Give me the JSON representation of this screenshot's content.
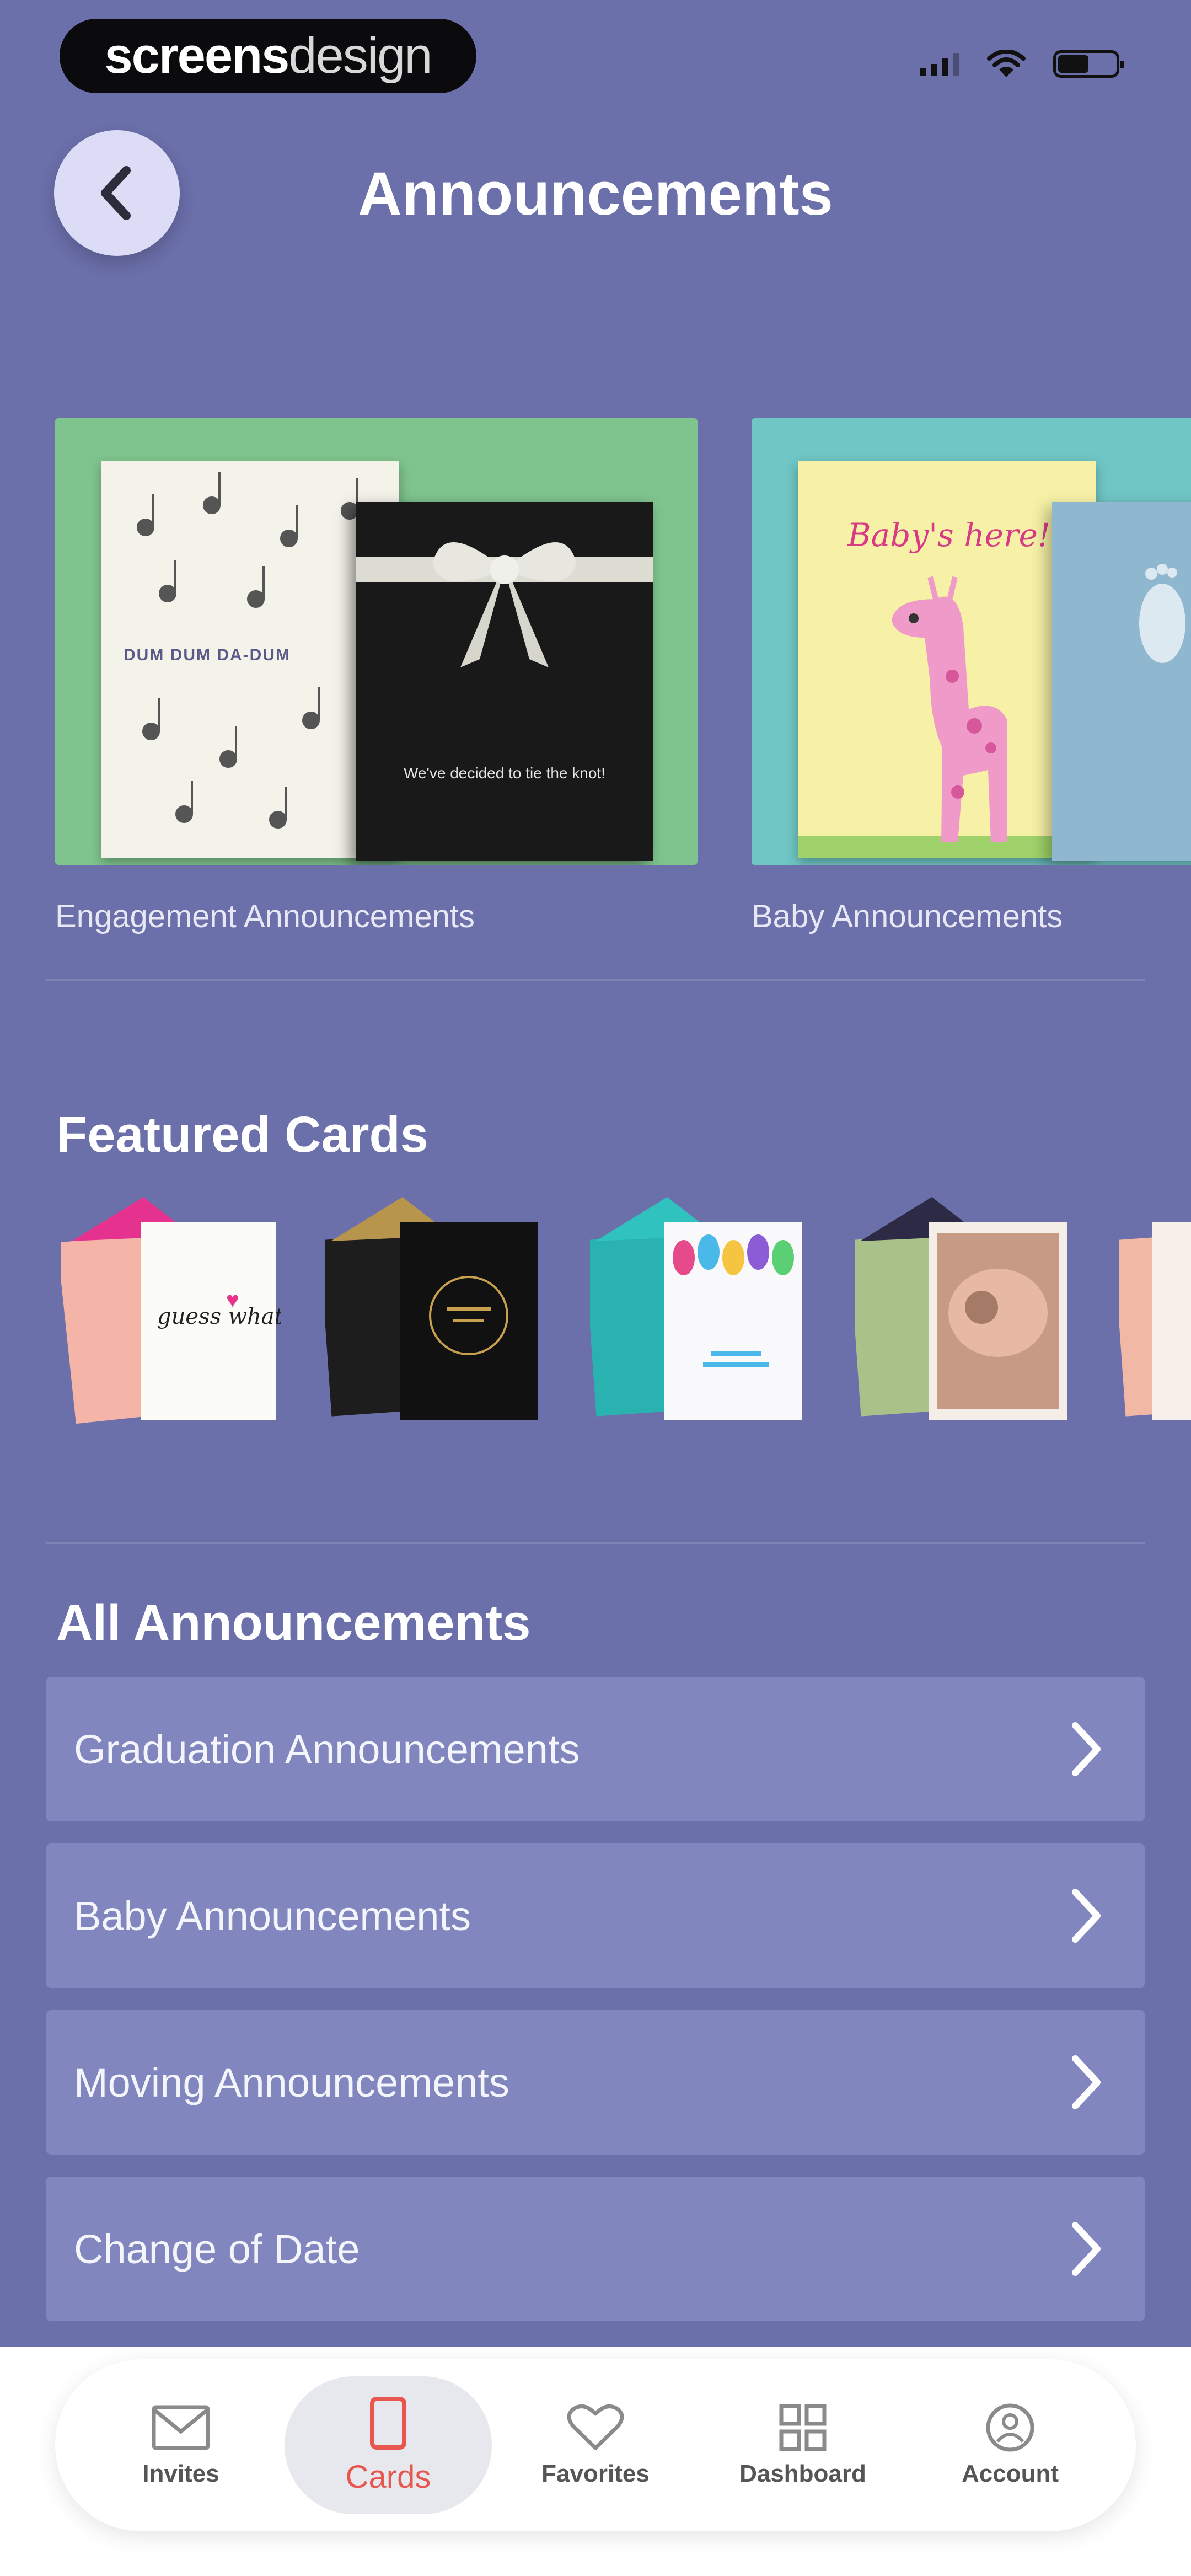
{
  "status_bar": {
    "brand_bold": "screens",
    "brand_light": "design"
  },
  "header": {
    "title": "Announcements",
    "back_icon": "chevron-left-icon"
  },
  "categories": [
    {
      "label": "Engagement Announcements",
      "card_text_1": "DUM DUM DA-DUM",
      "card_text_2": "We've decided to tie the knot!"
    },
    {
      "label": "Baby Announcements",
      "card_text_1": "Baby's here!"
    }
  ],
  "featured": {
    "title": "Featured Cards",
    "items": [
      {
        "text": "guess what?"
      },
      {
        "text": ""
      },
      {
        "text": ""
      },
      {
        "text": ""
      },
      {
        "text": ""
      }
    ]
  },
  "all_announcements": {
    "title": "All Announcements",
    "items": [
      {
        "label": "Graduation Announcements"
      },
      {
        "label": "Baby Announcements"
      },
      {
        "label": "Moving Announcements"
      },
      {
        "label": "Change of Date"
      }
    ]
  },
  "tabs": [
    {
      "label": "Invites",
      "icon": "envelope-icon"
    },
    {
      "label": "Cards",
      "icon": "card-icon",
      "active": true
    },
    {
      "label": "Favorites",
      "icon": "heart-icon"
    },
    {
      "label": "Dashboard",
      "icon": "grid-icon"
    },
    {
      "label": "Account",
      "icon": "user-icon"
    }
  ],
  "colors": {
    "background": "#6b6faa",
    "list_item": "#8286be",
    "active_tab": "#e8574e",
    "back_button": "#dcdcf6"
  }
}
